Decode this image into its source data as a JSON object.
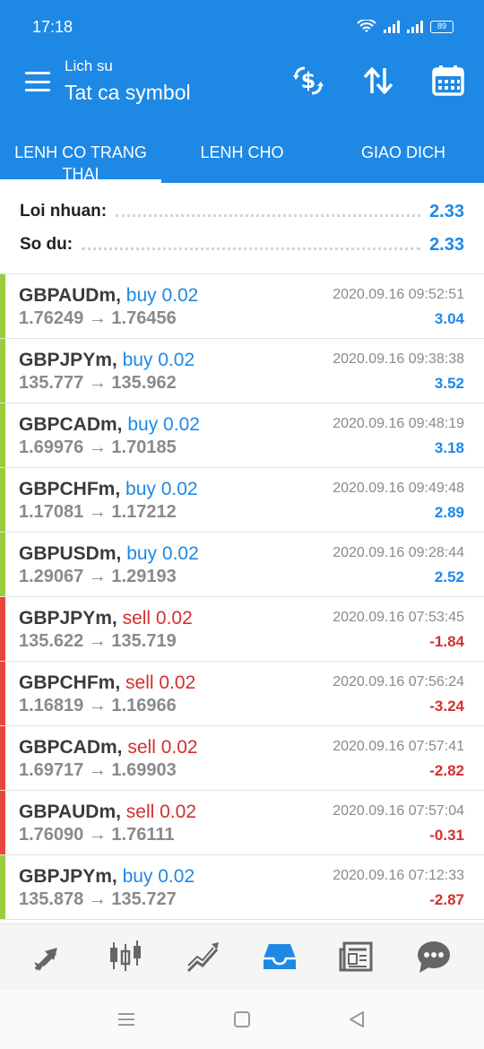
{
  "status_bar": {
    "time": "17:18",
    "battery": "89"
  },
  "header": {
    "subtitle": "Lich su",
    "title": "Tat ca symbol"
  },
  "tabs": [
    {
      "label": "LENH CO TRANG THAI",
      "active": true
    },
    {
      "label": "LENH CHO",
      "active": false
    },
    {
      "label": "GIAO DICH",
      "active": false
    }
  ],
  "summary": {
    "profit_label": "Loi nhuan:",
    "profit_value": "2.33",
    "balance_label": "So du:",
    "balance_value": "2.33"
  },
  "colors": {
    "accent": "#1e88e5",
    "buy": "#1e88e5",
    "sell": "#d32f2f",
    "buy_bar": "#9ccc3d",
    "sell_bar": "#e8483b"
  },
  "trades": [
    {
      "symbol": "GBPAUDm,",
      "side": "buy 0.02",
      "type": "buy",
      "prices": "1.76249 → 1.76456",
      "time": "2020.09.16 09:52:51",
      "profit": "3.04"
    },
    {
      "symbol": "GBPJPYm,",
      "side": "buy 0.02",
      "type": "buy",
      "prices": "135.777 → 135.962",
      "time": "2020.09.16 09:38:38",
      "profit": "3.52"
    },
    {
      "symbol": "GBPCADm,",
      "side": "buy 0.02",
      "type": "buy",
      "prices": "1.69976 → 1.70185",
      "time": "2020.09.16 09:48:19",
      "profit": "3.18"
    },
    {
      "symbol": "GBPCHFm,",
      "side": "buy 0.02",
      "type": "buy",
      "prices": "1.17081 → 1.17212",
      "time": "2020.09.16 09:49:48",
      "profit": "2.89"
    },
    {
      "symbol": "GBPUSDm,",
      "side": "buy 0.02",
      "type": "buy",
      "prices": "1.29067 → 1.29193",
      "time": "2020.09.16 09:28:44",
      "profit": "2.52"
    },
    {
      "symbol": "GBPJPYm,",
      "side": "sell 0.02",
      "type": "sell",
      "prices": "135.622 → 135.719",
      "time": "2020.09.16 07:53:45",
      "profit": "-1.84"
    },
    {
      "symbol": "GBPCHFm,",
      "side": "sell 0.02",
      "type": "sell",
      "prices": "1.16819 → 1.16966",
      "time": "2020.09.16 07:56:24",
      "profit": "-3.24"
    },
    {
      "symbol": "GBPCADm,",
      "side": "sell 0.02",
      "type": "sell",
      "prices": "1.69717 → 1.69903",
      "time": "2020.09.16 07:57:41",
      "profit": "-2.82"
    },
    {
      "symbol": "GBPAUDm,",
      "side": "sell 0.02",
      "type": "sell",
      "prices": "1.76090 → 1.76111",
      "time": "2020.09.16 07:57:04",
      "profit": "-0.31"
    },
    {
      "symbol": "GBPJPYm,",
      "side": "buy 0.02",
      "type": "buy",
      "prices": "135.878 → 135.727",
      "time": "2020.09.16 07:12:33",
      "profit": "-2.87"
    }
  ],
  "bottom_nav": [
    "trade-arrows-icon",
    "candlestick-icon",
    "chart-line-icon",
    "inbox-icon",
    "news-icon",
    "chat-icon"
  ],
  "bottom_nav_active": "inbox-icon"
}
